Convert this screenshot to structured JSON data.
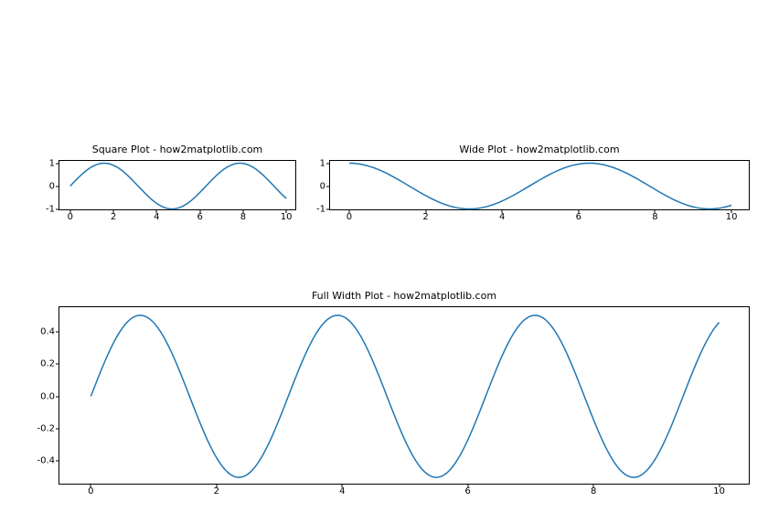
{
  "chart_data": [
    {
      "type": "line",
      "title": "Square Plot - how2matplotlib.com",
      "function": "sin(x)",
      "x_range": [
        0,
        10
      ],
      "x": [
        0,
        1.57,
        3.14,
        4.71,
        6.28,
        7.85,
        9.42,
        10
      ],
      "y": [
        0,
        1,
        0,
        -1,
        0,
        1,
        0,
        -0.54
      ],
      "xticks": [
        0,
        2,
        4,
        6,
        8,
        10
      ],
      "yticks": [
        -1,
        0,
        1
      ],
      "xlim": [
        -0.5,
        10.5
      ],
      "ylim": [
        -1.1,
        1.1
      ]
    },
    {
      "type": "line",
      "title": "Wide Plot - how2matplotlib.com",
      "function": "cos(x)",
      "x_range": [
        0,
        10
      ],
      "x": [
        0,
        1.57,
        3.14,
        4.71,
        6.28,
        7.85,
        9.42,
        10
      ],
      "y": [
        1,
        0,
        -1,
        0,
        1,
        0,
        -1,
        -0.84
      ],
      "xticks": [
        0,
        2,
        4,
        6,
        8,
        10
      ],
      "yticks": [
        -1,
        0,
        1
      ],
      "xlim": [
        -0.5,
        10.5
      ],
      "ylim": [
        -1.1,
        1.1
      ]
    },
    {
      "type": "line",
      "title": "Full Width Plot - how2matplotlib.com",
      "function": "sin(x)*cos(x)",
      "x_range": [
        0,
        10
      ],
      "x": [
        0,
        0.79,
        1.57,
        2.36,
        3.14,
        3.93,
        4.71,
        5.5,
        6.28,
        7.07,
        7.85,
        8.64,
        9.42,
        10
      ],
      "y": [
        0,
        0.5,
        0,
        -0.5,
        0,
        0.5,
        0,
        -0.5,
        0,
        0.5,
        0,
        -0.5,
        0,
        0.456
      ],
      "xticks": [
        0,
        2,
        4,
        6,
        8,
        10
      ],
      "yticks": [
        -0.4,
        -0.2,
        0.0,
        0.2,
        0.4
      ],
      "ytick_labels": [
        "-0.4",
        "-0.2",
        "0.0",
        "0.2",
        "0.4"
      ],
      "xlim": [
        -0.5,
        10.5
      ],
      "ylim": [
        -0.55,
        0.55
      ]
    }
  ],
  "line_color": "#1f77b4"
}
